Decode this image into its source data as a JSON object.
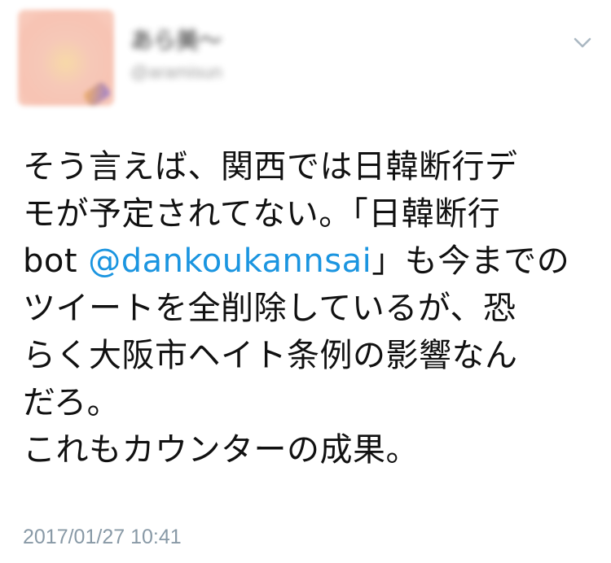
{
  "tweet": {
    "author": {
      "display_name": "あら美〜",
      "handle": "@aramisun"
    },
    "text_lines": [
      "そう言えば、関西では日韓断行デ",
      "モが予定されてない。「日韓断行",
      "",
      "ツイートを全削除しているが、恐",
      "らく大阪市ヘイト条例の影響なん",
      "だろ。",
      "これもカウンターの成果。"
    ],
    "line3": {
      "before": "bot ",
      "mention": "@dankoukannsai",
      "after": "」も今までの"
    },
    "timestamp": "2017/01/27 10:41"
  },
  "colors": {
    "text": "#111111",
    "mention": "#1b95e0",
    "timestamp": "#8899a6",
    "caret": "#aab8c2"
  },
  "icons": {
    "caret": "chevron-down-icon"
  }
}
